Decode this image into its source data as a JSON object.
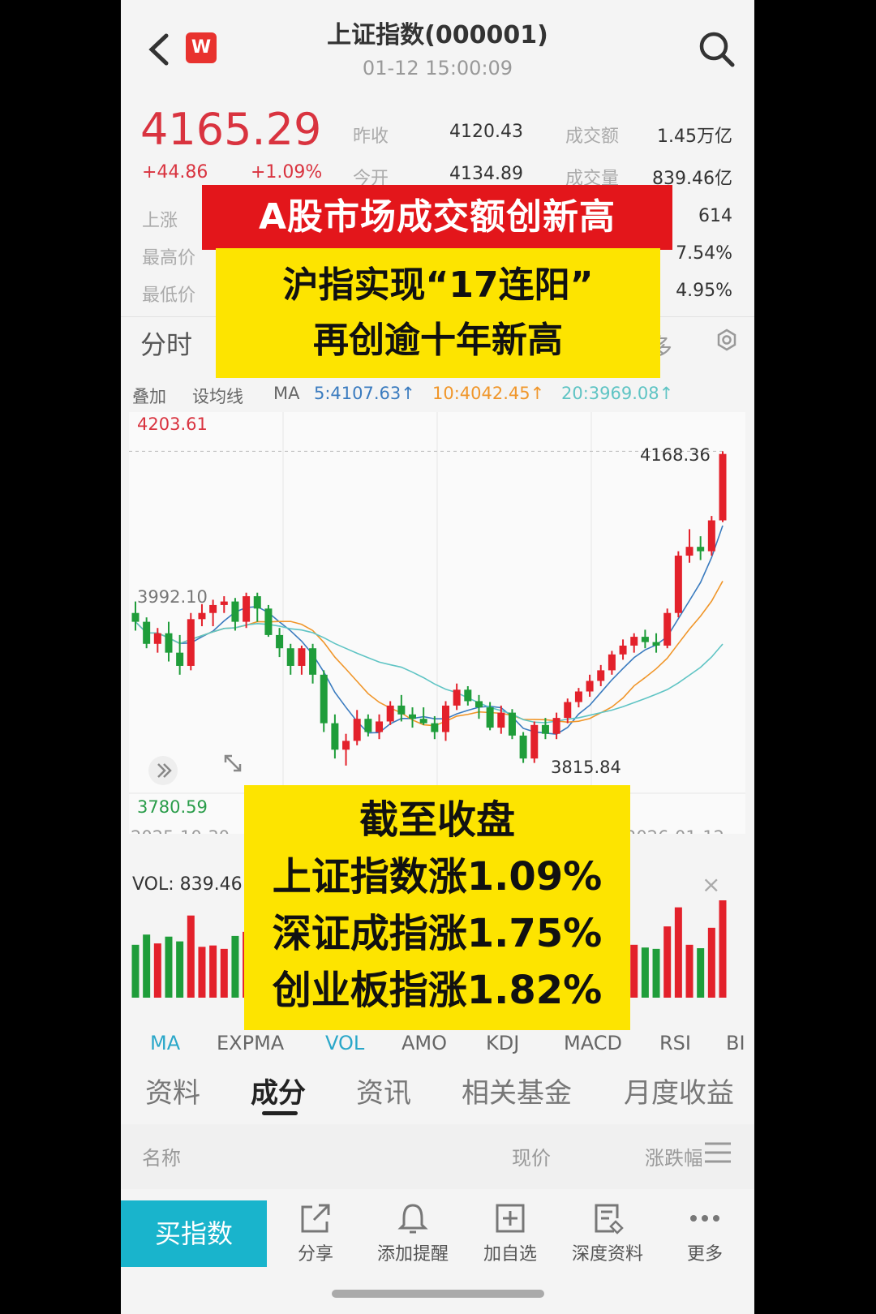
{
  "header": {
    "title": "上证指数(000001)",
    "time": "01-12 15:00:09",
    "logo_text": "W"
  },
  "quote": {
    "price": "4165.29",
    "change": "+44.86",
    "change_pct": "+1.09%",
    "prev_close_label": "昨收",
    "prev_close": "4120.43",
    "turnover_label": "成交额",
    "turnover": "1.45万亿",
    "open_label": "今开",
    "open": "4134.89",
    "volume_label": "成交量",
    "volume": "839.46亿",
    "up_label": "上涨",
    "up_right": "614",
    "high_label": "最高价",
    "high_right": "7.54%",
    "low_label": "最低价",
    "low_right": "4.95%"
  },
  "overlay": {
    "headline": "A股市场成交额创新高",
    "sub_line1": "沪指实现“17连阳”",
    "sub_line2": "再创逾十年新高",
    "close_title": "截至收盘",
    "close_line1": "上证指数涨1.09%",
    "close_line2": "深证成指涨1.75%",
    "close_line3": "创业板指涨1.82%"
  },
  "chart_tabs": {
    "fenshi": "分时",
    "partial_right": "多"
  },
  "ma_bar": {
    "overlay": "叠加",
    "set_ma": "设均线",
    "ma": "MA",
    "ma5": "5:4107.63↑",
    "ma10": "10:4042.45↑",
    "ma20": "20:3969.08↑",
    "ma5_color": "#3a7bbf",
    "ma10_color": "#f0962a",
    "ma20_color": "#5fc4c4"
  },
  "chart_data": {
    "type": "candlestick",
    "x_start": "2025-10-30",
    "x_end": "2026-01-12",
    "y_top_label": "4203.61",
    "y_bottom_label": "3780.59",
    "ylim": [
      3780.59,
      4203.61
    ],
    "annotations": {
      "high": "4168.36",
      "low": "3815.84",
      "mid": "3992.10"
    },
    "candles": [
      [
        3985,
        3998,
        3965,
        3975
      ],
      [
        3975,
        3980,
        3945,
        3950
      ],
      [
        3950,
        3968,
        3940,
        3962
      ],
      [
        3962,
        3975,
        3930,
        3940
      ],
      [
        3940,
        3960,
        3915,
        3925
      ],
      [
        3925,
        3985,
        3920,
        3978
      ],
      [
        3978,
        3995,
        3970,
        3985
      ],
      [
        3985,
        4000,
        3970,
        3994
      ],
      [
        3994,
        4004,
        3985,
        3998
      ],
      [
        3998,
        4002,
        3965,
        3975
      ],
      [
        3975,
        4008,
        3968,
        4004
      ],
      [
        4004,
        4008,
        3975,
        3990
      ],
      [
        3990,
        3994,
        3958,
        3960
      ],
      [
        3960,
        3968,
        3935,
        3945
      ],
      [
        3945,
        3950,
        3915,
        3925
      ],
      [
        3925,
        3948,
        3915,
        3945
      ],
      [
        3945,
        3950,
        3905,
        3915
      ],
      [
        3915,
        3920,
        3850,
        3860
      ],
      [
        3860,
        3870,
        3820,
        3830
      ],
      [
        3830,
        3848,
        3812,
        3840
      ],
      [
        3840,
        3875,
        3835,
        3865
      ],
      [
        3865,
        3870,
        3845,
        3850
      ],
      [
        3850,
        3870,
        3842,
        3862
      ],
      [
        3862,
        3885,
        3858,
        3880
      ],
      [
        3880,
        3892,
        3862,
        3870
      ],
      [
        3870,
        3878,
        3855,
        3865
      ],
      [
        3865,
        3878,
        3858,
        3860
      ],
      [
        3860,
        3868,
        3842,
        3850
      ],
      [
        3850,
        3885,
        3840,
        3880
      ],
      [
        3880,
        3905,
        3875,
        3898
      ],
      [
        3898,
        3902,
        3880,
        3885
      ],
      [
        3885,
        3892,
        3865,
        3878
      ],
      [
        3878,
        3884,
        3852,
        3855
      ],
      [
        3855,
        3880,
        3848,
        3872
      ],
      [
        3872,
        3876,
        3842,
        3846
      ],
      [
        3846,
        3850,
        3815,
        3820
      ],
      [
        3820,
        3862,
        3815,
        3858
      ],
      [
        3858,
        3866,
        3842,
        3848
      ],
      [
        3848,
        3872,
        3842,
        3866
      ],
      [
        3866,
        3888,
        3860,
        3884
      ],
      [
        3884,
        3900,
        3878,
        3896
      ],
      [
        3896,
        3915,
        3890,
        3908
      ],
      [
        3908,
        3926,
        3902,
        3920
      ],
      [
        3920,
        3942,
        3915,
        3938
      ],
      [
        3938,
        3955,
        3932,
        3948
      ],
      [
        3948,
        3962,
        3940,
        3958
      ],
      [
        3958,
        3966,
        3945,
        3952
      ],
      [
        3952,
        3962,
        3940,
        3948
      ],
      [
        3948,
        3990,
        3945,
        3985
      ],
      [
        3985,
        4055,
        3980,
        4050
      ],
      [
        4050,
        4080,
        4042,
        4060
      ],
      [
        4060,
        4072,
        4045,
        4055
      ],
      [
        4055,
        4095,
        4050,
        4090
      ],
      [
        4090,
        4168.36,
        4088,
        4165.29
      ]
    ]
  },
  "volume": {
    "label": "VOL: 839.46",
    "close_icon": "×"
  },
  "indicators": [
    "MA",
    "EXPMA",
    "VOL",
    "AMO",
    "KDJ",
    "MACD",
    "RSI",
    "BI"
  ],
  "sub_tabs": [
    "资料",
    "成分",
    "资讯",
    "相关基金",
    "月度收益"
  ],
  "table_head": {
    "name": "名称",
    "price": "现价",
    "change": "涨跌幅"
  },
  "bottom_bar": {
    "buy": "买指数",
    "share": "分享",
    "alert": "添加提醒",
    "add": "加自选",
    "deep": "深度资料",
    "more": "更多"
  }
}
